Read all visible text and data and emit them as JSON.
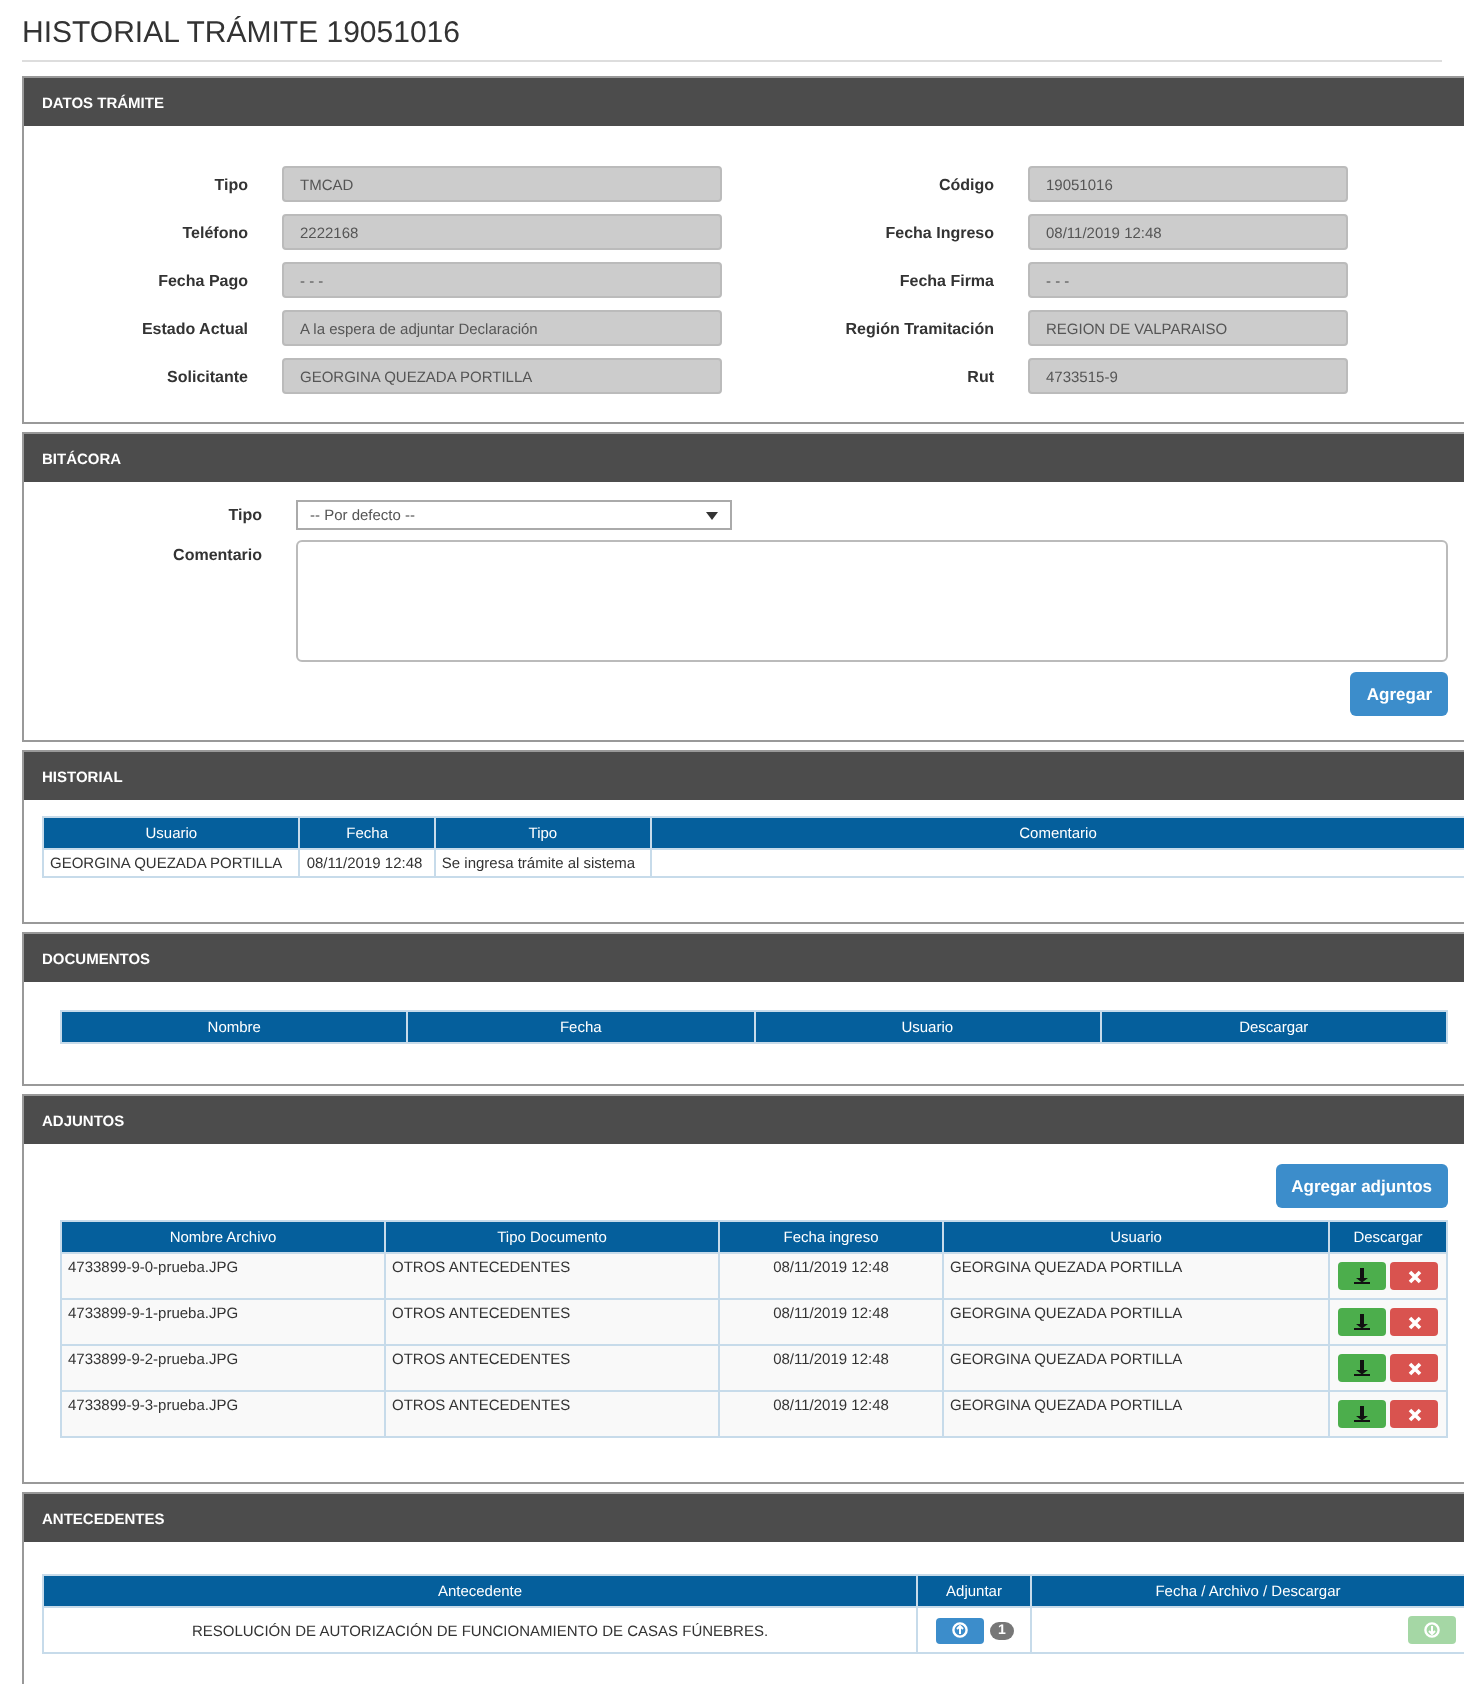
{
  "title": "HISTORIAL TRÁMITE 19051016",
  "datos_tramite": {
    "title": "DATOS TRÁMITE",
    "fields": [
      {
        "label": "Tipo",
        "value": "TMCAD"
      },
      {
        "label": "Código",
        "value": "19051016"
      },
      {
        "label": "Teléfono",
        "value": "2222168"
      },
      {
        "label": "Fecha Ingreso",
        "value": "08/11/2019 12:48"
      },
      {
        "label": "Fecha Pago",
        "value": "- - -"
      },
      {
        "label": "Fecha Firma",
        "value": "- - -"
      },
      {
        "label": "Estado Actual",
        "value": "A la espera de adjuntar Declaración"
      },
      {
        "label": "Región Tramitación",
        "value": "REGION DE VALPARAISO"
      },
      {
        "label": "Solicitante",
        "value": "GEORGINA QUEZADA PORTILLA"
      },
      {
        "label": "Rut",
        "value": "4733515-9"
      }
    ]
  },
  "bitacora": {
    "title": "BITÁCORA",
    "tipo_label": "Tipo",
    "tipo_value": "-- Por defecto --",
    "comentario_label": "Comentario",
    "button": "Agregar"
  },
  "historial": {
    "title": "HISTORIAL",
    "columns": [
      "Usuario",
      "Fecha",
      "Tipo",
      "Comentario"
    ],
    "rows": [
      [
        "GEORGINA QUEZADA PORTILLA",
        "08/11/2019 12:48",
        "Se ingresa trámite al sistema",
        ""
      ]
    ]
  },
  "documentos": {
    "title": "DOCUMENTOS",
    "columns": [
      "Nombre",
      "Fecha",
      "Usuario",
      "Descargar"
    ]
  },
  "adjuntos": {
    "title": "ADJUNTOS",
    "button": "Agregar adjuntos",
    "columns": [
      "Nombre Archivo",
      "Tipo Documento",
      "Fecha ingreso",
      "Usuario",
      "Descargar"
    ],
    "rows": [
      {
        "nombre": "4733899-9-0-prueba.JPG",
        "tipo": "OTROS ANTECEDENTES",
        "fecha": "08/11/2019 12:48",
        "usuario": "GEORGINA QUEZADA PORTILLA"
      },
      {
        "nombre": "4733899-9-1-prueba.JPG",
        "tipo": "OTROS ANTECEDENTES",
        "fecha": "08/11/2019 12:48",
        "usuario": "GEORGINA QUEZADA PORTILLA"
      },
      {
        "nombre": "4733899-9-2-prueba.JPG",
        "tipo": "OTROS ANTECEDENTES",
        "fecha": "08/11/2019 12:48",
        "usuario": "GEORGINA QUEZADA PORTILLA"
      },
      {
        "nombre": "4733899-9-3-prueba.JPG",
        "tipo": "OTROS ANTECEDENTES",
        "fecha": "08/11/2019 12:48",
        "usuario": "GEORGINA QUEZADA PORTILLA"
      }
    ]
  },
  "antecedentes": {
    "title": "ANTECEDENTES",
    "columns": [
      "Antecedente",
      "Adjuntar",
      "Fecha / Archivo / Descargar"
    ],
    "rows": [
      {
        "antecedente": "RESOLUCIÓN DE AUTORIZACIÓN DE FUNCIONAMIENTO DE CASAS FÚNEBRES.",
        "count": "1",
        "download_disabled": true
      }
    ]
  }
}
